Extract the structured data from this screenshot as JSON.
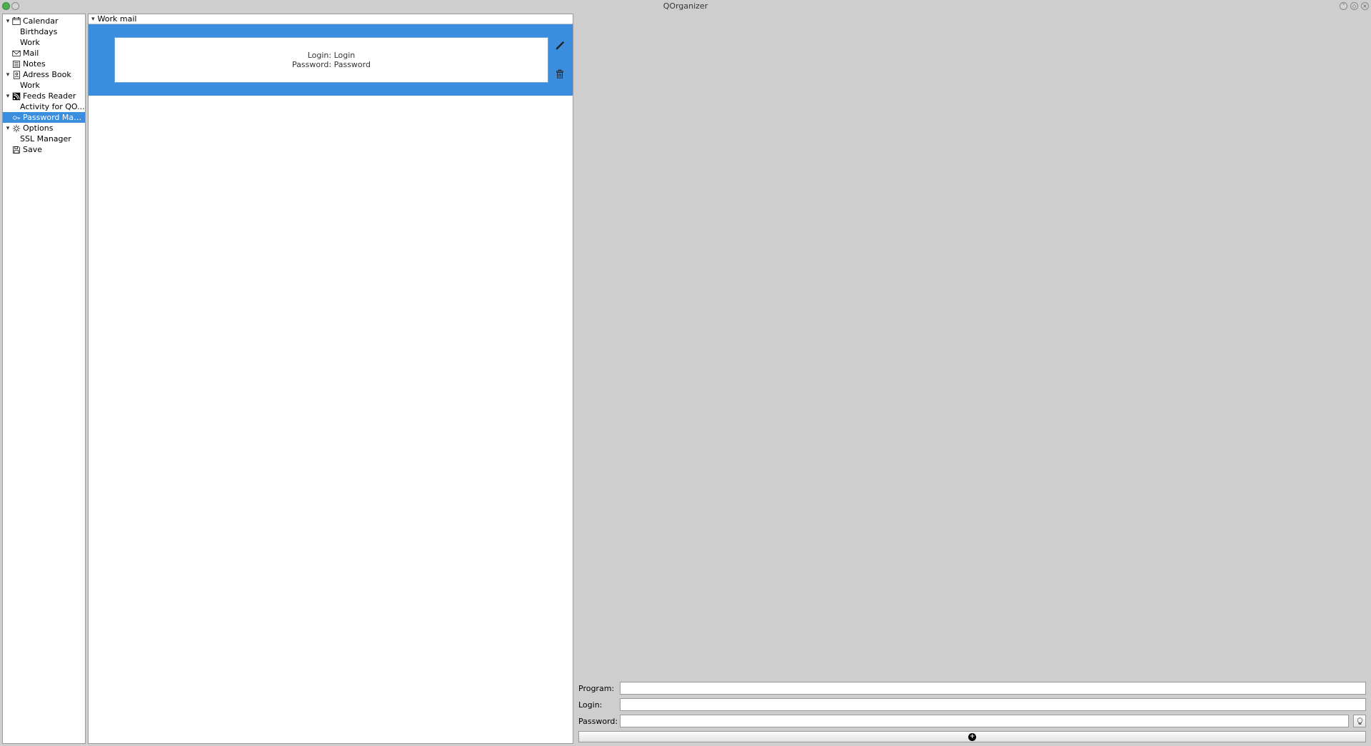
{
  "app": {
    "title": "QOrganizer"
  },
  "sidebar": {
    "items": [
      {
        "label": "Calendar",
        "icon": "calendar",
        "expandable": true
      },
      {
        "label": "Birthdays",
        "child": true
      },
      {
        "label": "Work",
        "child": true
      },
      {
        "label": "Mail",
        "icon": "mail"
      },
      {
        "label": "Notes",
        "icon": "notes"
      },
      {
        "label": "Adress Book",
        "icon": "address",
        "expandable": true
      },
      {
        "label": "Work",
        "child": true
      },
      {
        "label": "Feeds Reader",
        "icon": "feed",
        "expandable": true
      },
      {
        "label": "Activity for QO...",
        "child": true
      },
      {
        "label": "Password Man...",
        "icon": "key",
        "selected": true
      },
      {
        "label": "Options",
        "icon": "gear",
        "expandable": true
      },
      {
        "label": "SSL Manager",
        "child": true
      },
      {
        "label": "Save",
        "icon": "save"
      }
    ]
  },
  "center": {
    "header": "Work mail",
    "entry": {
      "login_label": "Login:",
      "login_value": "Login",
      "password_label": "Password:",
      "password_value": "Password"
    }
  },
  "form": {
    "program_label": "Program:",
    "login_label": "Login:",
    "password_label": "Password:",
    "program_value": "",
    "login_value": "",
    "password_value": ""
  }
}
